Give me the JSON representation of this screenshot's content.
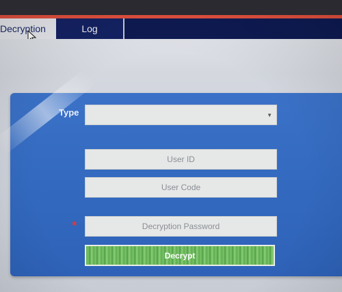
{
  "tabs": {
    "decryption_label": "Decryption",
    "log_label": "Log"
  },
  "form": {
    "type_label": "Type",
    "type_value": "",
    "user_id_placeholder": "User ID",
    "user_code_placeholder": "User Code",
    "required_marker": "*",
    "password_placeholder": "Decryption Password",
    "decrypt_label": "Decrypt"
  },
  "colors": {
    "tabbar": "#0e1a52",
    "panel": "#336ac0",
    "button": "#5fae50",
    "accent_line": "#e0503e"
  }
}
